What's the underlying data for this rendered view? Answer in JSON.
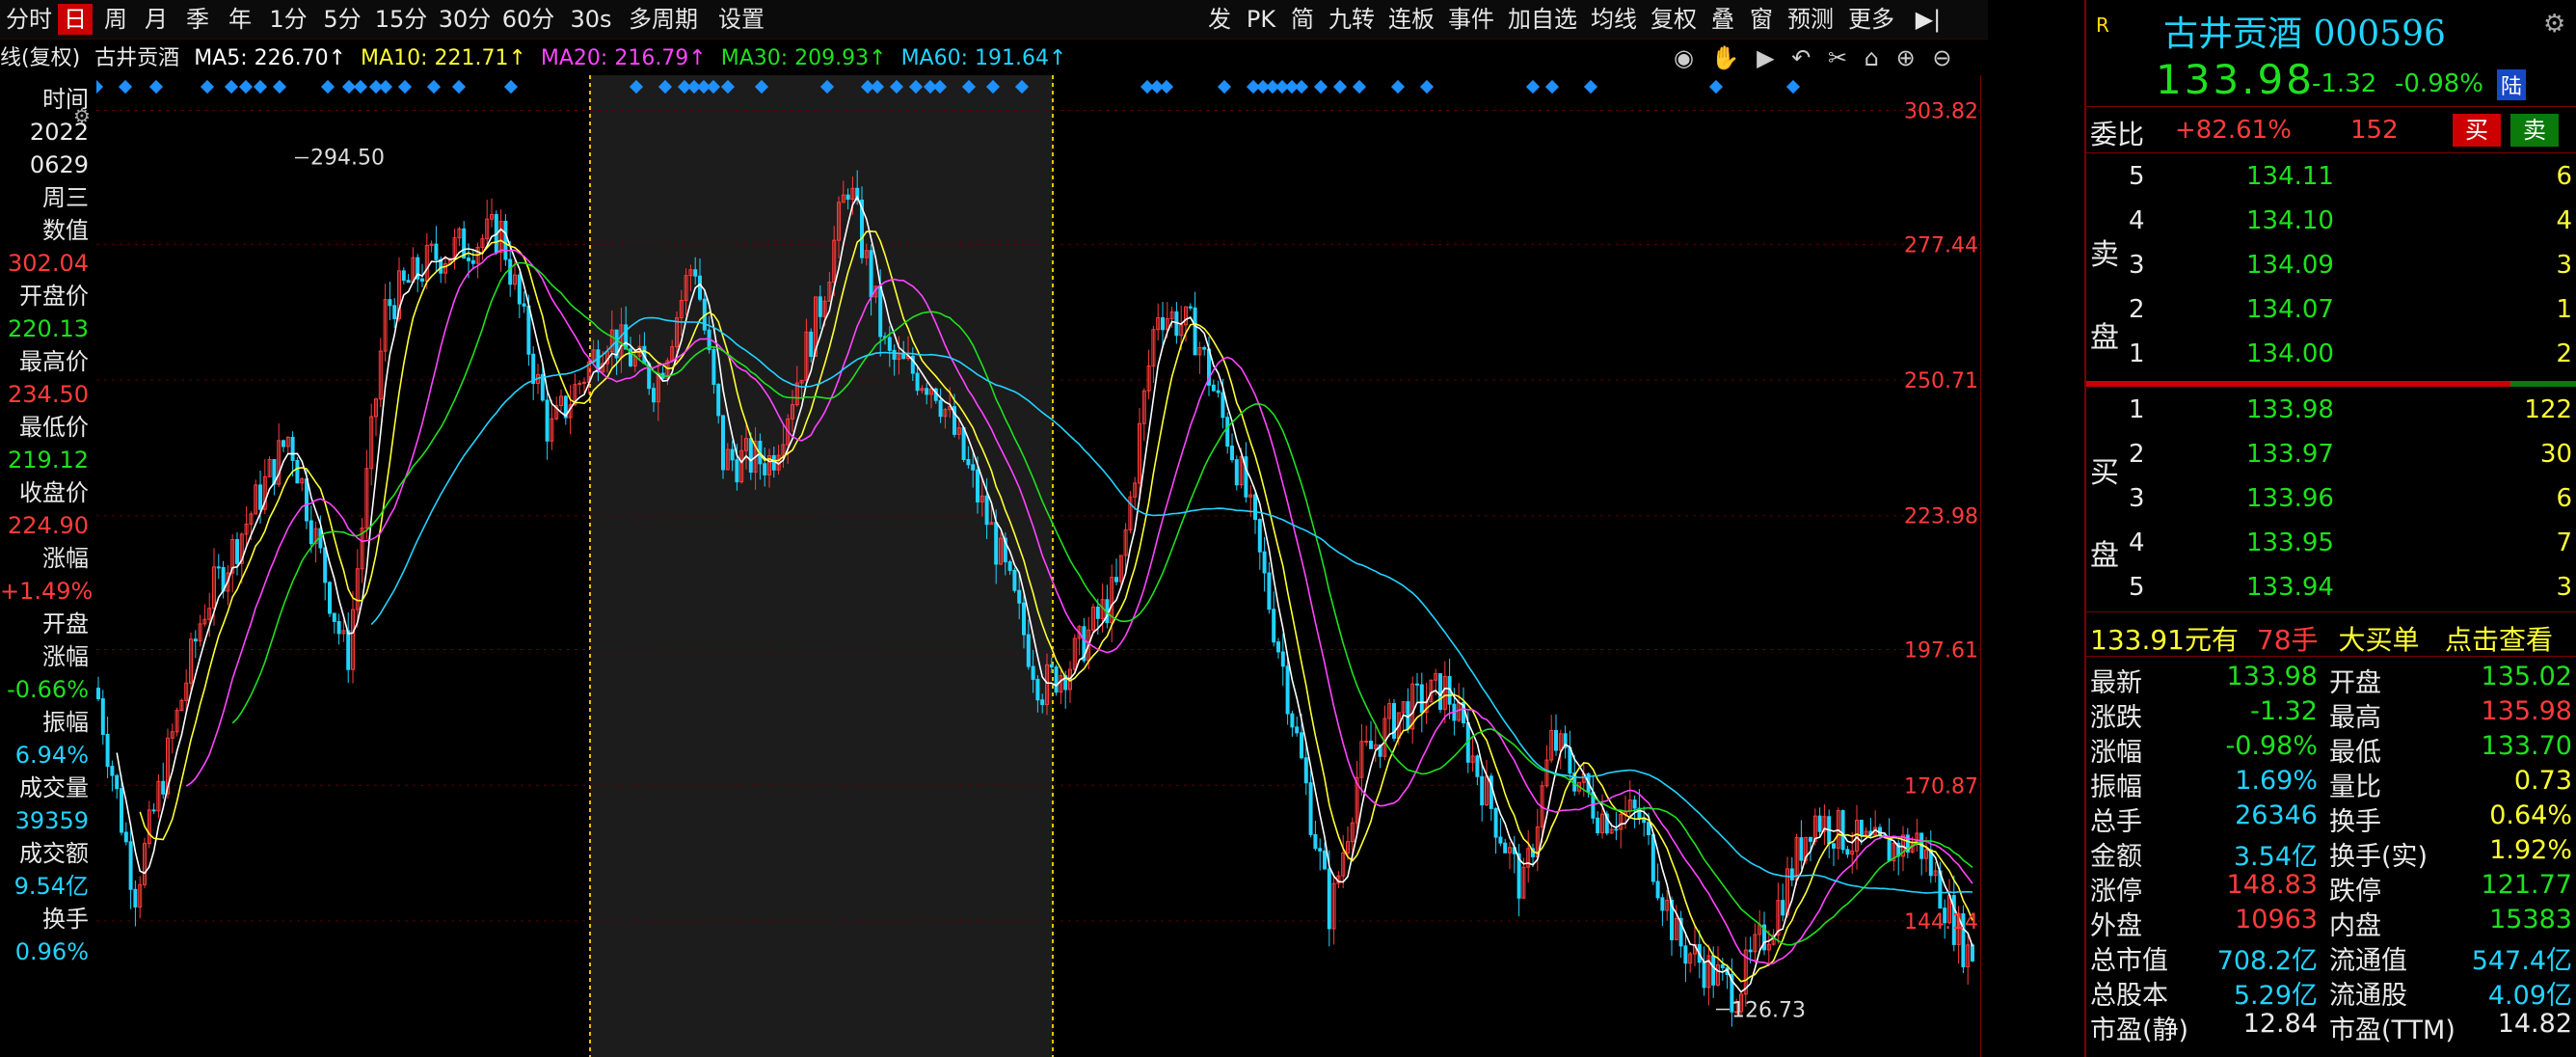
{
  "toolbar": {
    "left": [
      "分时",
      "日",
      "周",
      "月",
      "季",
      "年",
      "1分",
      "5分",
      "15分",
      "30分",
      "60分",
      "30s",
      "多周期",
      "设置"
    ],
    "right": [
      "发",
      "PK",
      "简",
      "九转",
      "连板",
      "事件",
      "加自选",
      "均线",
      "复权",
      "叠",
      "窗",
      "预测",
      "更多"
    ]
  },
  "ma": {
    "title": "线(复权)",
    "stock": "古井贡酒",
    "ma5": "MA5: 226.70↑",
    "ma10": "MA10: 221.71↑",
    "ma20": "MA20: 216.79↑",
    "ma30": "MA30: 209.93↑",
    "ma60": "MA60: 191.64↑"
  },
  "leftinfo": {
    "labels": [
      {
        "t": "时间",
        "c": "white"
      },
      {
        "t": "2022",
        "c": "white"
      },
      {
        "t": "0629",
        "c": "white"
      },
      {
        "t": "周三",
        "c": "white"
      },
      {
        "t": "数值",
        "c": "white"
      },
      {
        "t": "302.04",
        "c": "red"
      },
      {
        "t": "开盘价",
        "c": "white"
      },
      {
        "t": "220.13",
        "c": "green"
      },
      {
        "t": "最高价",
        "c": "white"
      },
      {
        "t": "234.50",
        "c": "red"
      },
      {
        "t": "最低价",
        "c": "white"
      },
      {
        "t": "219.12",
        "c": "green"
      },
      {
        "t": "收盘价",
        "c": "white"
      },
      {
        "t": "224.90",
        "c": "red"
      },
      {
        "t": "涨幅",
        "c": "white"
      },
      {
        "t": "+1.49%",
        "c": "red"
      },
      {
        "t": "开盘",
        "c": "white"
      },
      {
        "t": "涨幅",
        "c": "white"
      },
      {
        "t": "-0.66%",
        "c": "green"
      },
      {
        "t": "振幅",
        "c": "white"
      },
      {
        "t": "6.94%",
        "c": "cyan"
      },
      {
        "t": "成交量",
        "c": "white"
      },
      {
        "t": "39359",
        "c": "cyan"
      },
      {
        "t": "成交额",
        "c": "white"
      },
      {
        "t": "9.54亿",
        "c": "cyan"
      },
      {
        "t": "换手",
        "c": "white"
      },
      {
        "t": "0.96%",
        "c": "cyan"
      }
    ]
  },
  "axis": {
    "ticks": [
      "303.82",
      "277.44",
      "250.71",
      "223.98",
      "197.61",
      "170.87",
      "144.14"
    ],
    "high_label": "294.50",
    "low_label": "126.73"
  },
  "quote": {
    "name": "古井贡酒",
    "code": "000596",
    "price": "133.98",
    "change": "-1.32",
    "pct": "-0.98%",
    "lu": "陆",
    "webi_label": "委比",
    "webi": "+82.61%",
    "webi_n": "152",
    "buy": "买",
    "sell": "卖",
    "sell_label": "卖\n盘",
    "buy_label": "买\n盘",
    "asks": [
      {
        "lvl": "5",
        "price": "134.11",
        "vol": "6"
      },
      {
        "lvl": "4",
        "price": "134.10",
        "vol": "4"
      },
      {
        "lvl": "3",
        "price": "134.09",
        "vol": "3"
      },
      {
        "lvl": "2",
        "price": "134.07",
        "vol": "1"
      },
      {
        "lvl": "1",
        "price": "134.00",
        "vol": "2"
      }
    ],
    "bids": [
      {
        "lvl": "1",
        "price": "133.98",
        "vol": "122"
      },
      {
        "lvl": "2",
        "price": "133.97",
        "vol": "30"
      },
      {
        "lvl": "3",
        "price": "133.96",
        "vol": "6"
      },
      {
        "lvl": "4",
        "price": "133.95",
        "vol": "7"
      },
      {
        "lvl": "5",
        "price": "133.94",
        "vol": "3"
      }
    ],
    "bigorder": {
      "price": "133.91元有",
      "hands": "78手",
      "label": "大买单",
      "link": "点击查看"
    },
    "stats": [
      {
        "l1": "最新",
        "v1": "133.98",
        "c1": "green",
        "l2": "开盘",
        "v2": "135.02",
        "c2": "green"
      },
      {
        "l1": "涨跌",
        "v1": "-1.32",
        "c1": "green",
        "l2": "最高",
        "v2": "135.98",
        "c2": "red"
      },
      {
        "l1": "涨幅",
        "v1": "-0.98%",
        "c1": "green",
        "l2": "最低",
        "v2": "133.70",
        "c2": "green"
      },
      {
        "l1": "振幅",
        "v1": "1.69%",
        "c1": "cyan",
        "l2": "量比",
        "v2": "0.73",
        "c2": "yellow"
      },
      {
        "l1": "总手",
        "v1": "26346",
        "c1": "cyan",
        "l2": "换手",
        "v2": "0.64%",
        "c2": "yellow"
      },
      {
        "l1": "金额",
        "v1": "3.54亿",
        "c1": "cyan",
        "l2": "换手(实)",
        "v2": "1.92%",
        "c2": "yellow"
      },
      {
        "l1": "涨停",
        "v1": "148.83",
        "c1": "red",
        "l2": "跌停",
        "v2": "121.77",
        "c2": "green"
      },
      {
        "l1": "外盘",
        "v1": "10963",
        "c1": "red",
        "l2": "内盘",
        "v2": "15383",
        "c2": "green"
      },
      {
        "l1": "总市值",
        "v1": "708.2亿",
        "c1": "cyan",
        "l2": "流通值",
        "v2": "547.4亿",
        "c2": "cyan"
      },
      {
        "l1": "总股本",
        "v1": "5.29亿",
        "c1": "cyan",
        "l2": "流通股",
        "v2": "4.09亿",
        "c2": "cyan"
      },
      {
        "l1": "市盈(静)",
        "v1": "12.84",
        "c1": "white",
        "l2": "市盈(TTM)",
        "v2": "14.82",
        "c2": "white"
      }
    ]
  },
  "colors": {
    "up": "#ff3b3b",
    "down": "#1fe01f",
    "ma5": "#ffffff",
    "ma10": "#ffff33",
    "ma20": "#ff44ff",
    "ma30": "#1fe01f",
    "ma60": "#22d3ff"
  }
}
